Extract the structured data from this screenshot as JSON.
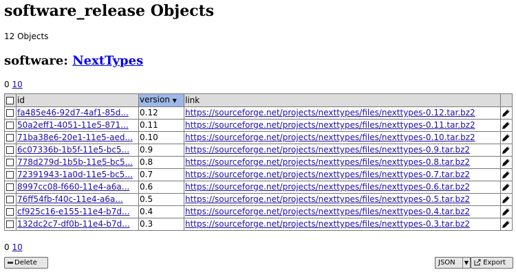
{
  "title": "software_release Objects",
  "count_text": "12 Objects",
  "subtitle": {
    "label": "software:",
    "link": "NextTypes"
  },
  "pager": {
    "first": "0",
    "last": "10"
  },
  "table": {
    "columns": {
      "id": "id",
      "version": "version",
      "link": "link"
    },
    "sort_arrow": "▼",
    "rows": [
      {
        "id": "fa485e46-92d7-4af1-85d...",
        "version": "0.12",
        "link": "https://sourceforge.net/projects/nexttypes/files/nexttypes-0.12.tar.bz2"
      },
      {
        "id": "50a2eff1-4051-11e5-871...",
        "version": "0.11",
        "link": "https://sourceforge.net/projects/nexttypes/files/nexttypes-0.11.tar.bz2"
      },
      {
        "id": "71ba38e6-20e1-11e5-aed...",
        "version": "0.10",
        "link": "https://sourceforge.net/projects/nexttypes/files/nexttypes-0.10.tar.bz2"
      },
      {
        "id": "6c07336b-1b5f-11e5-bc5...",
        "version": "0.9",
        "link": "https://sourceforge.net/projects/nexttypes/files/nexttypes-0.9.tar.bz2"
      },
      {
        "id": "778d279d-1b5b-11e5-bc5...",
        "version": "0.8",
        "link": "https://sourceforge.net/projects/nexttypes/files/nexttypes-0.8.tar.bz2"
      },
      {
        "id": "72391943-1a0d-11e5-bc5...",
        "version": "0.7",
        "link": "https://sourceforge.net/projects/nexttypes/files/nexttypes-0.7.tar.bz2"
      },
      {
        "id": "8997cc08-f660-11e4-a6a...",
        "version": "0.6",
        "link": "https://sourceforge.net/projects/nexttypes/files/nexttypes-0.6.tar.bz2"
      },
      {
        "id": "76ff54fb-f40c-11e4-a6a...",
        "version": "0.5",
        "link": "https://sourceforge.net/projects/nexttypes/files/nexttypes-0.5.tar.bz2"
      },
      {
        "id": "cf925c16-e155-11e4-b7d...",
        "version": "0.4",
        "link": "https://sourceforge.net/projects/nexttypes/files/nexttypes-0.4.tar.bz2"
      },
      {
        "id": "132dc2c7-df0b-11e4-b7d...",
        "version": "0.3",
        "link": "https://sourceforge.net/projects/nexttypes/files/nexttypes-0.3.tar.bz2"
      }
    ]
  },
  "actions": {
    "delete": "Delete",
    "format": "JSON",
    "export": "Export"
  },
  "icons": {
    "edit": "pencil-icon",
    "delete": "minus-icon",
    "export": "export-icon"
  }
}
